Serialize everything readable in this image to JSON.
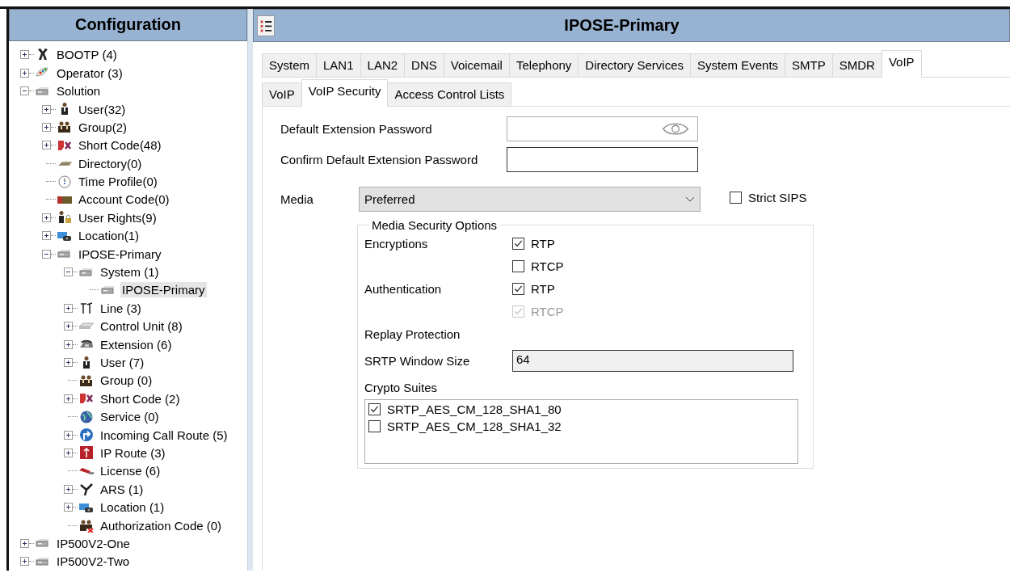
{
  "sidebar": {
    "title": "Configuration",
    "tree": [
      {
        "label": "BOOTP (4)",
        "kind": "tool",
        "expanded": false,
        "selected": false
      },
      {
        "label": "Operator (3)",
        "kind": "palette",
        "expanded": false,
        "selected": false
      },
      {
        "label": "Solution",
        "kind": "server",
        "expanded": true,
        "selected": false,
        "children": [
          {
            "label": "User(32)",
            "kind": "person",
            "expanded": false,
            "selected": false
          },
          {
            "label": "Group(2)",
            "kind": "people",
            "expanded": false,
            "selected": false
          },
          {
            "label": "Short Code(48)",
            "kind": "code",
            "expanded": false,
            "selected": false
          },
          {
            "label": "Directory(0)",
            "kind": "directory",
            "selected": false
          },
          {
            "label": "Time Profile(0)",
            "kind": "clock",
            "selected": false
          },
          {
            "label": "Account Code(0)",
            "kind": "card",
            "selected": false
          },
          {
            "label": "User Rights(9)",
            "kind": "rights",
            "expanded": false,
            "selected": false
          },
          {
            "label": "Location(1)",
            "kind": "location",
            "expanded": false,
            "selected": false
          },
          {
            "label": "IPOSE-Primary",
            "kind": "server",
            "expanded": true,
            "selected": false,
            "children": [
              {
                "label": "System (1)",
                "kind": "server",
                "expanded": true,
                "selected": false,
                "children": [
                  {
                    "label": "IPOSE-Primary",
                    "kind": "server",
                    "selected": true
                  }
                ]
              },
              {
                "label": "Line (3)",
                "kind": "line",
                "expanded": false,
                "selected": false
              },
              {
                "label": "Control Unit (8)",
                "kind": "unit",
                "expanded": false,
                "selected": false
              },
              {
                "label": "Extension (6)",
                "kind": "phone",
                "expanded": false,
                "selected": false
              },
              {
                "label": "User (7)",
                "kind": "person",
                "expanded": false,
                "selected": false
              },
              {
                "label": "Group (0)",
                "kind": "people",
                "selected": false
              },
              {
                "label": "Short Code (2)",
                "kind": "code",
                "expanded": false,
                "selected": false
              },
              {
                "label": "Service (0)",
                "kind": "globe",
                "selected": false
              },
              {
                "label": "Incoming Call Route (5)",
                "kind": "route",
                "expanded": false,
                "selected": false
              },
              {
                "label": "IP Route (3)",
                "kind": "iproute",
                "expanded": false,
                "selected": false
              },
              {
                "label": "License (6)",
                "kind": "license",
                "selected": false
              },
              {
                "label": "ARS (1)",
                "kind": "ars",
                "expanded": false,
                "selected": false
              },
              {
                "label": "Location (1)",
                "kind": "location",
                "expanded": false,
                "selected": false
              },
              {
                "label": "Authorization Code (0)",
                "kind": "auth",
                "selected": false
              }
            ]
          }
        ]
      },
      {
        "label": "IP500V2-One",
        "kind": "server",
        "expanded": false,
        "selected": false
      },
      {
        "label": "IP500V2-Two",
        "kind": "server",
        "expanded": false,
        "selected": false
      }
    ]
  },
  "header": {
    "title": "IPOSE-Primary"
  },
  "tabs": [
    {
      "label": "System",
      "selected": false
    },
    {
      "label": "LAN1",
      "selected": false
    },
    {
      "label": "LAN2",
      "selected": false
    },
    {
      "label": "DNS",
      "selected": false
    },
    {
      "label": "Voicemail",
      "selected": false
    },
    {
      "label": "Telephony",
      "selected": false
    },
    {
      "label": "Directory Services",
      "selected": false
    },
    {
      "label": "System Events",
      "selected": false
    },
    {
      "label": "SMTP",
      "selected": false
    },
    {
      "label": "SMDR",
      "selected": false
    },
    {
      "label": "VoIP",
      "selected": true
    }
  ],
  "subtabs": [
    {
      "label": "VoIP",
      "selected": false
    },
    {
      "label": "VoIP Security",
      "selected": true
    },
    {
      "label": "Access Control Lists",
      "selected": false
    }
  ],
  "form": {
    "password": {
      "label": "Default Extension Password"
    },
    "confirm_password": {
      "label": "Confirm Default Extension Password"
    },
    "media": {
      "label": "Media",
      "value": "Preferred"
    },
    "strict_sips": {
      "label": "Strict SIPS",
      "checked": false
    },
    "media_security": {
      "title": "Media Security Options",
      "encryptions": {
        "label": "Encryptions",
        "options": [
          {
            "label": "RTP",
            "checked": true,
            "disabled": false
          },
          {
            "label": "RTCP",
            "checked": false,
            "disabled": false
          }
        ]
      },
      "authentication": {
        "label": "Authentication",
        "options": [
          {
            "label": "RTP",
            "checked": true,
            "disabled": false
          },
          {
            "label": "RTCP",
            "checked": true,
            "disabled": true
          }
        ]
      },
      "replay_protection": {
        "label": "Replay Protection"
      },
      "srtp_window_size": {
        "label": "SRTP Window Size",
        "value": "64"
      },
      "crypto_suites": {
        "label": "Crypto Suites",
        "items": [
          {
            "label": "SRTP_AES_CM_128_SHA1_80",
            "checked": true
          },
          {
            "label": "SRTP_AES_CM_128_SHA1_32",
            "checked": false
          }
        ]
      }
    }
  }
}
